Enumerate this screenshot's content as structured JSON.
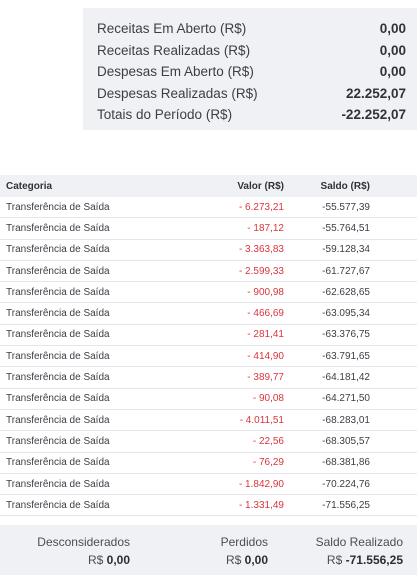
{
  "summary": [
    {
      "label": "Receitas Em Aberto (R$)",
      "value": "0,00"
    },
    {
      "label": "Receitas Realizadas (R$)",
      "value": "0,00"
    },
    {
      "label": "Despesas Em Aberto (R$)",
      "value": "0,00"
    },
    {
      "label": "Despesas Realizadas (R$)",
      "value": "22.252,07"
    },
    {
      "label": "Totais do Período (R$)",
      "value": "-22.252,07"
    }
  ],
  "table": {
    "headers": {
      "categoria": "Categoria",
      "valor": "Valor (R$)",
      "saldo": "Saldo (R$)"
    },
    "rows": [
      {
        "categoria": "Transferência de Saída",
        "valor": "- 6.273,21",
        "saldo": "-55.577,39"
      },
      {
        "categoria": "Transferência de Saída",
        "valor": "- 187,12",
        "saldo": "-55.764,51"
      },
      {
        "categoria": "Transferência de Saída",
        "valor": "- 3.363,83",
        "saldo": "-59.128,34"
      },
      {
        "categoria": "Transferência de Saída",
        "valor": "- 2.599,33",
        "saldo": "-61.727,67"
      },
      {
        "categoria": "Transferência de Saída",
        "valor": "- 900,98",
        "saldo": "-62.628,65"
      },
      {
        "categoria": "Transferência de Saída",
        "valor": "- 466,69",
        "saldo": "-63.095,34"
      },
      {
        "categoria": "Transferência de Saída",
        "valor": "- 281,41",
        "saldo": "-63.376,75"
      },
      {
        "categoria": "Transferência de Saída",
        "valor": "- 414,90",
        "saldo": "-63.791,65"
      },
      {
        "categoria": "Transferência de Saída",
        "valor": "- 389,77",
        "saldo": "-64.181,42"
      },
      {
        "categoria": "Transferência de Saída",
        "valor": "- 90,08",
        "saldo": "-64.271,50"
      },
      {
        "categoria": "Transferência de Saída",
        "valor": "- 4.011,51",
        "saldo": "-68.283,01"
      },
      {
        "categoria": "Transferência de Saída",
        "valor": "- 22,56",
        "saldo": "-68.305,57"
      },
      {
        "categoria": "Transferência de Saída",
        "valor": "- 76,29",
        "saldo": "-68.381,86"
      },
      {
        "categoria": "Transferência de Saída",
        "valor": "- 1.842,90",
        "saldo": "-70.224,76"
      },
      {
        "categoria": "Transferência de Saída",
        "valor": "- 1.331,49",
        "saldo": "-71.556,25"
      }
    ]
  },
  "footer": {
    "desconsiderados": {
      "label": "Desconsiderados",
      "currency": "R$",
      "value": "0,00"
    },
    "perdidos": {
      "label": "Perdidos",
      "currency": "R$",
      "value": "0,00"
    },
    "saldo_realizado": {
      "label": "Saldo Realizado",
      "currency": "R$",
      "value": "-71.556,25"
    }
  },
  "colors": {
    "negative": "#d9363e",
    "panel": "#f0f1f4"
  }
}
